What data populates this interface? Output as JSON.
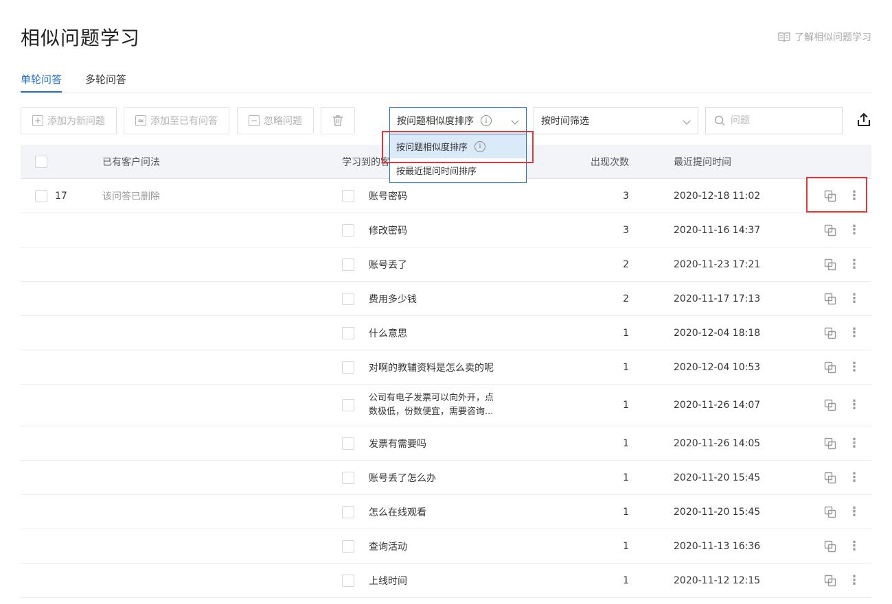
{
  "page": {
    "title": "相似问题学习",
    "learn_link": "了解相似问题学习"
  },
  "tabs": [
    {
      "label": "单轮问答",
      "active": true
    },
    {
      "label": "多轮问答",
      "active": false
    }
  ],
  "toolbar": {
    "add_new": "添加为新问题",
    "add_existing": "添加至已有问答",
    "ignore": "忽略问题",
    "sort_select": "按问题相似度排序",
    "time_filter": "按时间筛选",
    "search_placeholder": "问题"
  },
  "sort_menu": {
    "options": [
      "按问题相似度排序",
      "按最近提问时间排序"
    ],
    "selected_index": 0
  },
  "table": {
    "headers": {
      "existing": "已有客户问法",
      "learned": "学习到的客",
      "count": "出现次数",
      "recent": "最近提问时间"
    },
    "group": {
      "count": "17",
      "status": "该问答已删除"
    },
    "rows": [
      {
        "question": "账号密码",
        "count": "3",
        "time": "2020-12-18 11:02"
      },
      {
        "question": "修改密码",
        "count": "3",
        "time": "2020-11-16 14:37"
      },
      {
        "question": "账号丢了",
        "count": "2",
        "time": "2020-11-23 17:21"
      },
      {
        "question": "费用多少钱",
        "count": "2",
        "time": "2020-11-17 17:13"
      },
      {
        "question": "什么意思",
        "count": "1",
        "time": "2020-12-04 18:18"
      },
      {
        "question": "对啊的教辅资料是怎么卖的呢",
        "count": "1",
        "time": "2020-12-04 10:53"
      },
      {
        "question": "公司有电子发票可以向外开，点",
        "question2": "数极低，份数便宜，需要咨询...",
        "count": "1",
        "time": "2020-11-26 14:07"
      },
      {
        "question": "发票有需要吗",
        "count": "1",
        "time": "2020-11-26 14:05"
      },
      {
        "question": "账号丢了怎么办",
        "count": "1",
        "time": "2020-11-20 15:45"
      },
      {
        "question": "怎么在线观看",
        "count": "1",
        "time": "2020-11-20 15:45"
      },
      {
        "question": "查询活动",
        "count": "1",
        "time": "2020-11-13 16:36"
      },
      {
        "question": "上线时间",
        "count": "1",
        "time": "2020-11-12 12:15"
      }
    ]
  },
  "colors": {
    "accent": "#1f6fd1",
    "highlight": "#e5373a",
    "header_bg": "#f2f4f7",
    "selected_option_bg": "#dbeaf9"
  },
  "icons": [
    "book-icon",
    "plus-box-icon",
    "approx-box-icon",
    "minus-box-icon",
    "trash-icon",
    "info-icon",
    "chevron-down-icon",
    "search-icon",
    "export-icon",
    "copy-icon",
    "more-icon"
  ]
}
